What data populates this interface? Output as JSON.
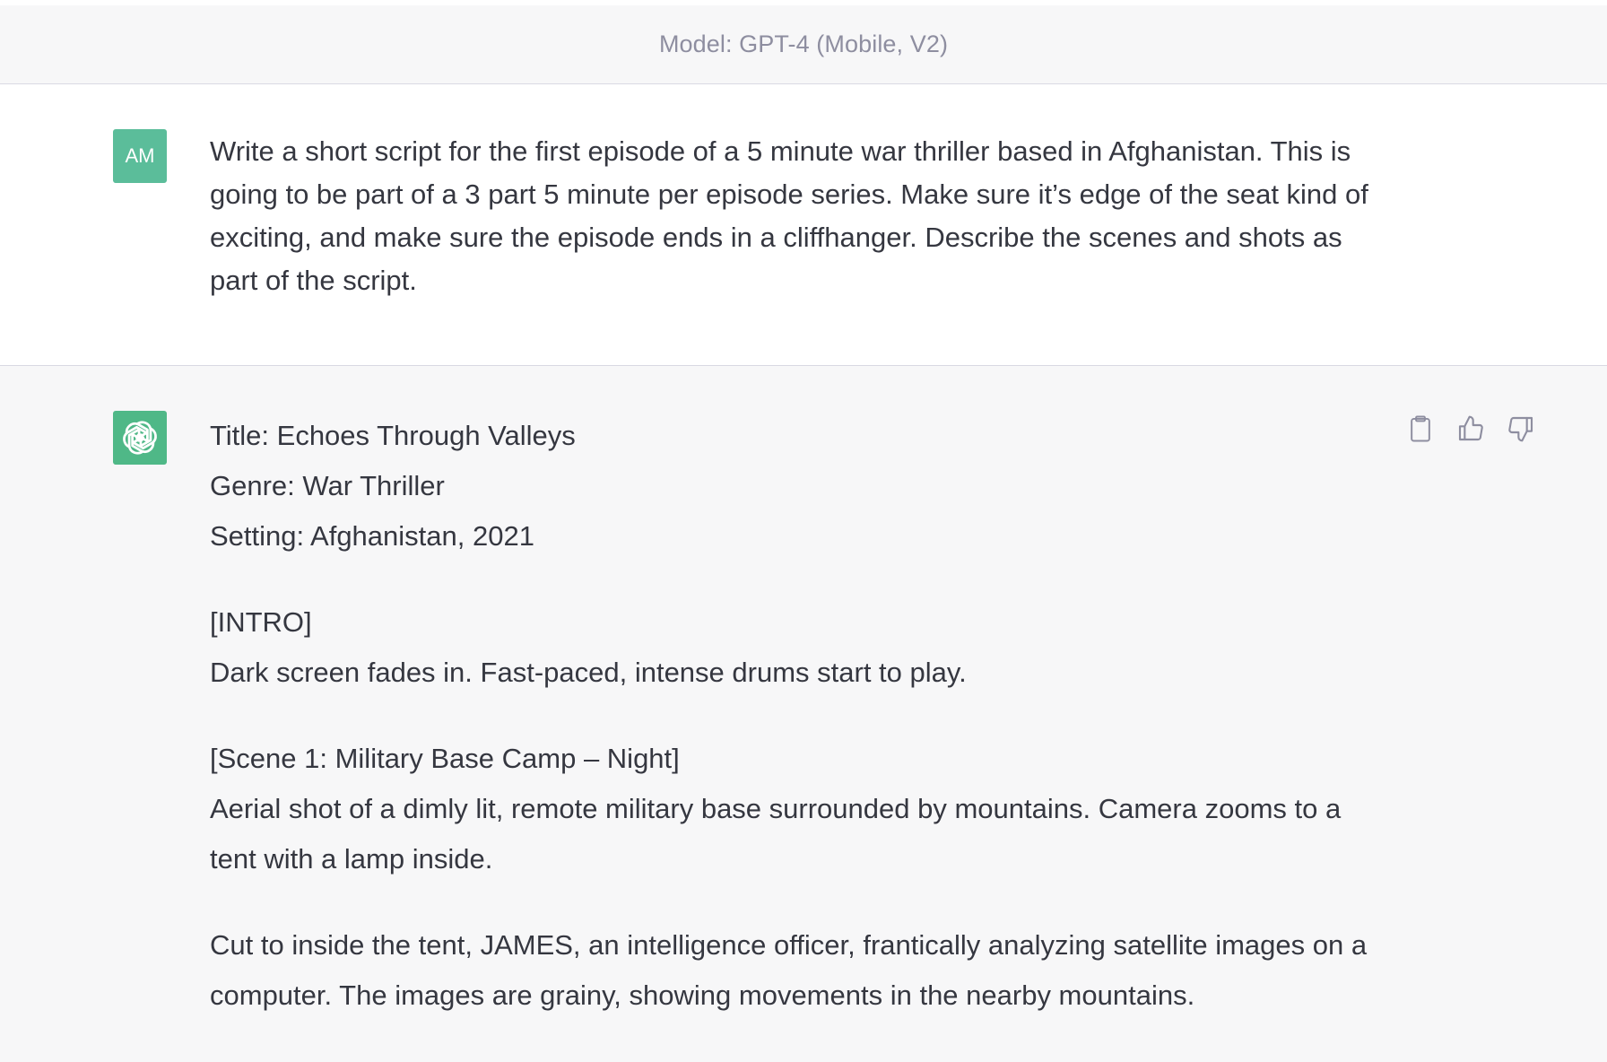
{
  "header": {
    "model_label": "Model: GPT-4 (Mobile, V2)"
  },
  "user_message": {
    "avatar_initials": "AM",
    "text": "Write a short script for the first episode of a 5 minute war thriller based in Afghanistan. This is going to be part of a 3 part 5 minute per episode series. Make sure it’s edge of the seat kind of exciting, and make sure the episode ends in a cliffhanger. Describe the scenes and shots as part of the script."
  },
  "assistant_message": {
    "avatar_icon": "openai-logo-icon",
    "actions": {
      "copy_icon": "clipboard-icon",
      "like_icon": "thumbs-up-icon",
      "dislike_icon": "thumbs-down-icon"
    },
    "lines": {
      "title": "Title: Echoes Through Valleys",
      "genre": "Genre: War Thriller",
      "setting": "Setting: Afghanistan, 2021",
      "intro_heading": "[INTRO]",
      "intro_text": "Dark screen fades in. Fast-paced, intense drums start to play.",
      "scene1_heading": "[Scene 1: Military Base Camp – Night]",
      "scene1_text": "Aerial shot of a dimly lit, remote military base surrounded by mountains. Camera zooms to a tent with a lamp inside.",
      "scene1_text2": "Cut to inside the tent, JAMES, an intelligence officer, frantically analyzing satellite images on a computer. The images are grainy, showing movements in the nearby mountains."
    }
  },
  "colors": {
    "user_avatar": "#5bbd9a",
    "bot_avatar": "#4fb887",
    "header_bg": "#f7f7f8",
    "assistant_bg": "#f7f7f8",
    "text": "#353740",
    "muted": "#8e8ea0"
  }
}
